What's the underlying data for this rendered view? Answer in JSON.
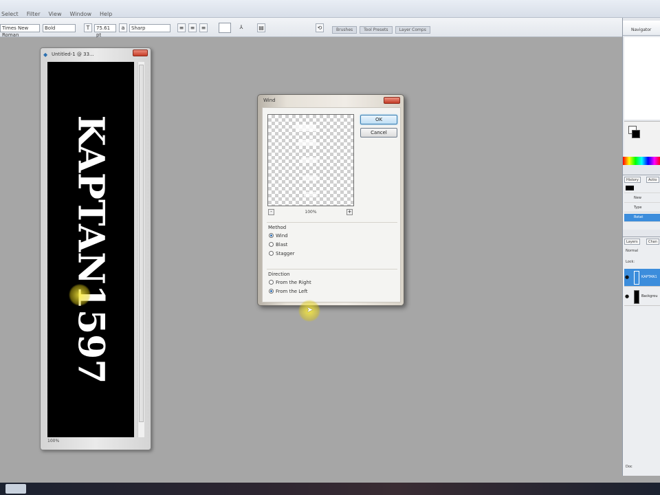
{
  "menu": [
    "Select",
    "Filter",
    "View",
    "Window",
    "Help"
  ],
  "options": {
    "font_family": "Times New Roman",
    "font_style": "Bold",
    "font_size": "75.61 pt",
    "antialias": "Sharp",
    "palette_tabs": [
      "Brushes",
      "Tool Presets",
      "Layer Comps"
    ]
  },
  "document": {
    "title": "Untitled-1 @ 33...",
    "canvas_text": "KAPTAN1597",
    "zoom": "100%"
  },
  "dialog": {
    "title": "Wind",
    "zoom": "100%",
    "ok_label": "OK",
    "cancel_label": "Cancel",
    "method_label": "Method",
    "methods": [
      "Wind",
      "Blast",
      "Stagger"
    ],
    "method_selected": "Wind",
    "direction_label": "Direction",
    "directions": [
      "From the Right",
      "From the Left"
    ],
    "direction_selected": "From the Left"
  },
  "panels": {
    "navigator_tab": "Navigator",
    "history_tab": "History",
    "actions_tab": "Actio",
    "history_items": [
      "New",
      "Type",
      "Rotat"
    ],
    "layers_tab": "Layers",
    "channels_tab": "Chan",
    "blend_mode": "Normal",
    "lock_label": "Lock:",
    "layers": [
      "KAPTAN1",
      "Backgrou"
    ],
    "status": "Doc"
  },
  "colors": {
    "canvas": "#000000",
    "canvas_text": "#ffffff",
    "highlight": "#f0e040",
    "selection": "#3c8ddc"
  }
}
